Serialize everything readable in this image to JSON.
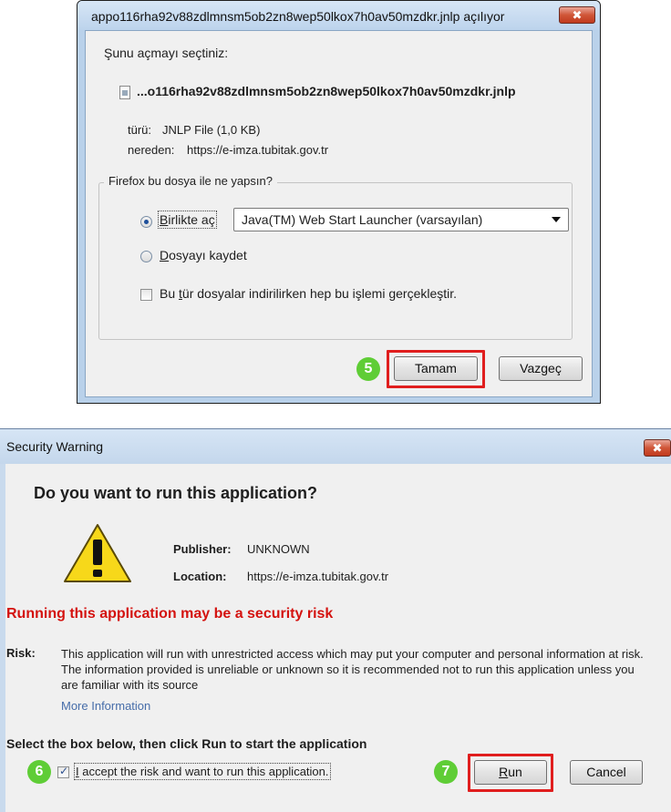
{
  "firefox_dialog": {
    "title": "appo116rha92v88zdlmnsm5ob2zn8wep50lkox7h0av50mzdkr.jnlp açılıyor",
    "close_label": "✖",
    "prompt": "Şunu açmayı seçtiniz:",
    "filename": "...o116rha92v88zdlmnsm5ob2zn8wep50lkox7h0av50mzdkr.jnlp",
    "type_label": "türü:",
    "type_value": "JNLP File (1,0 KB)",
    "from_label": "nereden:",
    "from_value": "https://e-imza.tubitak.gov.tr",
    "group_label": "Firefox bu dosya ile ne yapsın?",
    "open_with": {
      "prefix": "",
      "accel": "B",
      "rest": "irlikte aç",
      "selected": true
    },
    "open_with_app": "Java(TM) Web Start Launcher (varsayılan)",
    "save_file": {
      "accel": "D",
      "rest": "osyayı kaydet",
      "selected": false
    },
    "remember": {
      "prefix": "Bu ",
      "accel": "t",
      "rest": "ür dosyalar indirilirken hep bu işlemi gerçekleştir.",
      "checked": false
    },
    "ok_button": "Tamam",
    "cancel_button": "Vazgeç",
    "step_badge": "5"
  },
  "security_dialog": {
    "title": "Security Warning",
    "close_label": "✖",
    "heading": "Do you want to run this application?",
    "publisher_label": "Publisher:",
    "publisher_value": "UNKNOWN",
    "location_label": "Location:",
    "location_value": "https://e-imza.tubitak.gov.tr",
    "risk_heading": "Running this application may be a security risk",
    "risk_label": "Risk:",
    "risk_text": "This application will run with unrestricted access which may put your computer and personal information at risk. The information provided is unreliable or unknown so it is recommended not to run this application unless you are familiar with its source",
    "more_info": "More Information",
    "instruction": "Select the box below, then click Run to start the application",
    "accept_label": {
      "accel": "I",
      "rest": " accept the risk and want to run this application."
    },
    "accept_checked": true,
    "run_button": {
      "accel": "R",
      "rest": "un"
    },
    "cancel_button": "Cancel",
    "step_badge_check": "6",
    "step_badge_run": "7"
  },
  "colors": {
    "highlight": "#e01e1e",
    "badge": "#5fcd36",
    "risk_text": "#d4120f",
    "link": "#466da9"
  }
}
